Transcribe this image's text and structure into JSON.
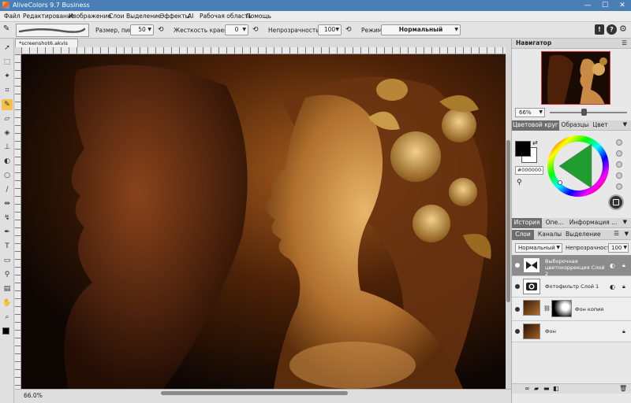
{
  "app": {
    "title": "AliveColors 9.7 Business"
  },
  "window_controls": {
    "minimize": "—",
    "maximize": "☐",
    "close": "✕"
  },
  "menu": [
    "Файл",
    "Редактирование",
    "Изображение",
    "Слои",
    "Выделение",
    "Эффекты",
    "AI",
    "Рабочая область",
    "Помощь"
  ],
  "toolbar": {
    "size_label": "Размер, пикс",
    "size_value": "50",
    "hardness_label": "Жесткость краев, %",
    "hardness_value": "0",
    "opacity_label": "Непрозрачность, %",
    "opacity_value": "100",
    "mode_label": "Режим:",
    "mode_value": "Нормальный"
  },
  "document": {
    "tab_name": "*screenshot6.akvis",
    "zoom": "66.0%"
  },
  "tools": [
    "move-tool-icon",
    "marquee-icon",
    "magic-wand-icon",
    "crop-icon",
    "brush-icon",
    "eraser-icon",
    "fill-icon",
    "stamp-icon",
    "dodge-icon",
    "blur-icon",
    "smudge-icon",
    "mirror-icon",
    "transform-icon",
    "pen-icon",
    "text-icon",
    "shape-icon",
    "eyedropper-icon",
    "gradient-icon",
    "hand-icon",
    "zoom-icon"
  ],
  "navigator": {
    "title": "Навигатор",
    "zoom": "66%"
  },
  "color_panel": {
    "tabs": [
      "Цветовой круг",
      "Образцы",
      "Цвет"
    ],
    "hex": "#000000",
    "foreground": "#000000",
    "background": "#ffffff"
  },
  "history_panel": {
    "tabs": [
      "История",
      "Опе...",
      "Информация ..."
    ]
  },
  "layers_panel": {
    "tabs": [
      "Слои",
      "Каналы",
      "Выделение"
    ],
    "mode": "Нормальный",
    "opacity_label": "Непрозрачность",
    "opacity_value": "100",
    "layers": [
      {
        "name": "Выборочная цветокоррекция Слой 2"
      },
      {
        "name": "Фотофильтр Слой 1"
      },
      {
        "name": "Фон копия"
      },
      {
        "name": "Фон"
      }
    ]
  },
  "colors": {
    "accent": "#f3c14b",
    "titlebar": "#4a7fb5"
  }
}
